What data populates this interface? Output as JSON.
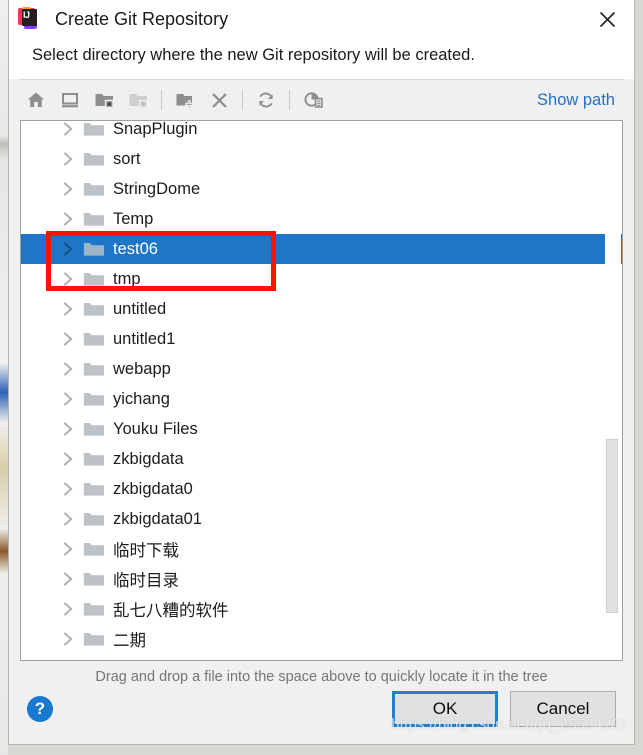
{
  "window": {
    "title": "Create Git Repository",
    "app_icon": "intellij-idea-icon",
    "close_label": "✕"
  },
  "subtitle": "Select directory where the new Git repository will be created.",
  "toolbar": {
    "buttons": [
      {
        "name": "home-icon",
        "tooltip": "Home",
        "disabled": false
      },
      {
        "name": "desktop-icon",
        "tooltip": "Desktop",
        "disabled": false
      },
      {
        "name": "project-folder-icon",
        "tooltip": "Project Directory",
        "disabled": false
      },
      {
        "name": "module-folder-icon",
        "tooltip": "Module Directory",
        "disabled": true
      },
      {
        "name": "new-folder-icon",
        "tooltip": "New Folder",
        "disabled": false
      },
      {
        "name": "delete-icon",
        "tooltip": "Delete",
        "disabled": false
      },
      {
        "name": "refresh-icon",
        "tooltip": "Refresh",
        "disabled": false
      },
      {
        "name": "hide-path-icon",
        "tooltip": "Show Hidden Files and Directories",
        "disabled": false
      }
    ],
    "show_path_label": "Show path"
  },
  "tree": {
    "rows": [
      {
        "label": "SnapPlugin",
        "selected": false
      },
      {
        "label": "sort",
        "selected": false
      },
      {
        "label": "StringDome",
        "selected": false
      },
      {
        "label": "Temp",
        "selected": false
      },
      {
        "label": "test06",
        "selected": true
      },
      {
        "label": "tmp",
        "selected": false
      },
      {
        "label": "untitled",
        "selected": false
      },
      {
        "label": "untitled1",
        "selected": false
      },
      {
        "label": "webapp",
        "selected": false
      },
      {
        "label": "yichang",
        "selected": false
      },
      {
        "label": "Youku Files",
        "selected": false
      },
      {
        "label": "zkbigdata",
        "selected": false
      },
      {
        "label": "zkbigdata0",
        "selected": false
      },
      {
        "label": "zkbigdata01",
        "selected": false
      },
      {
        "label": "临时下载",
        "selected": false
      },
      {
        "label": "临时目录",
        "selected": false
      },
      {
        "label": "乱七八糟的软件",
        "selected": false
      },
      {
        "label": "二期",
        "selected": false
      }
    ],
    "selection_color": "#1d76c7",
    "annotation_color": "#f91400"
  },
  "hint": "Drag and drop a file into the space above to quickly locate it in the tree",
  "footer": {
    "help_label": "?",
    "ok_label": "OK",
    "cancel_label": "Cancel"
  },
  "watermark": "https://blog.csdn.net/qq_25534101"
}
